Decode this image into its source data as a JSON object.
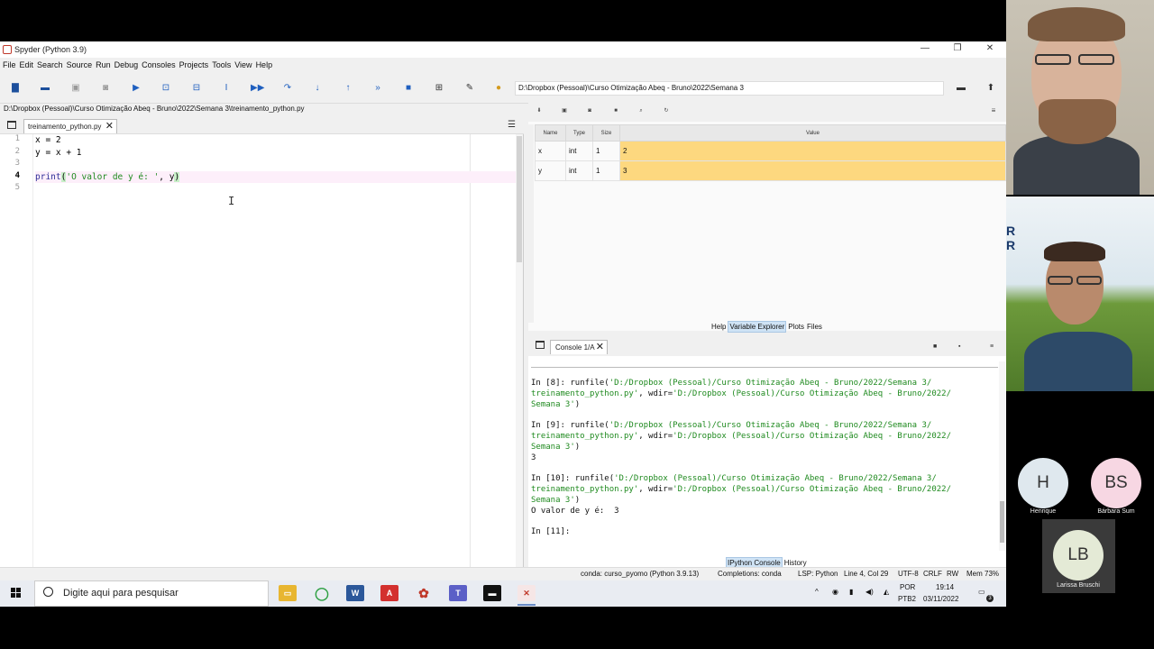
{
  "window": {
    "title": "Spyder (Python 3.9)",
    "controls": {
      "minimize": "—",
      "maximize": "❐",
      "close": "✕"
    }
  },
  "menu": [
    "File",
    "Edit",
    "Search",
    "Source",
    "Run",
    "Debug",
    "Consoles",
    "Projects",
    "Tools",
    "View",
    "Help"
  ],
  "toolbar": {
    "working_dir": "D:\\Dropbox (Pessoal)\\Curso Otimização Abeq - Bruno\\2022\\Semana 3"
  },
  "editor": {
    "file_path": "D:\\Dropbox (Pessoal)\\Curso Otimização Abeq - Bruno\\2022\\Semana 3\\treinamento_python.py",
    "tab_label": "treinamento_python.py",
    "line_numbers": [
      "1",
      "2",
      "3",
      "4",
      "5"
    ],
    "code": {
      "line1": "x = 2",
      "line2": "y = x + 1",
      "line3": "",
      "line4_kw": "print",
      "line4_open": "(",
      "line4_str": "'O valor de y é: '",
      "line4_rest": ", y",
      "line4_close": ")",
      "line5": ""
    }
  },
  "variable_explorer": {
    "columns": [
      "Name",
      "Type",
      "Size",
      "Value"
    ],
    "rows": [
      {
        "name": "x",
        "type": "int",
        "size": "1",
        "value": "2"
      },
      {
        "name": "y",
        "type": "int",
        "size": "1",
        "value": "3"
      }
    ],
    "tabs": [
      "Help",
      "Variable Explorer",
      "Plots",
      "Files"
    ],
    "value_color": "#fdd87f"
  },
  "console": {
    "tab_label": "Console 1/A",
    "blocks": [
      {
        "prompt": "In [8]: ",
        "cmd": "runfile(",
        "arg": "'D:/Dropbox (Pessoal)/Curso Otimização Abeq - Bruno/2022/Semana 3/",
        "arg2": "treinamento_python.py'",
        "mid": ", wdir=",
        "arg3": "'D:/Dropbox (Pessoal)/Curso Otimização Abeq - Bruno/2022/",
        "arg4": "Semana 3'",
        "end": ")",
        "output": ""
      },
      {
        "prompt": "In [9]: ",
        "cmd": "runfile(",
        "arg": "'D:/Dropbox (Pessoal)/Curso Otimização Abeq - Bruno/2022/Semana 3/",
        "arg2": "treinamento_python.py'",
        "mid": ", wdir=",
        "arg3": "'D:/Dropbox (Pessoal)/Curso Otimização Abeq - Bruno/2022/",
        "arg4": "Semana 3'",
        "end": ")",
        "output": "3"
      },
      {
        "prompt": "In [10]: ",
        "cmd": "runfile(",
        "arg": "'D:/Dropbox (Pessoal)/Curso Otimização Abeq - Bruno/2022/Semana 3/",
        "arg2": "treinamento_python.py'",
        "mid": ", wdir=",
        "arg3": "'D:/Dropbox (Pessoal)/Curso Otimização Abeq - Bruno/2022/",
        "arg4": "Semana 3'",
        "end": ")",
        "output": "O valor de y é:  3"
      }
    ],
    "current_prompt": "In [11]:",
    "tabs": [
      "IPython Console",
      "History"
    ]
  },
  "statusbar": {
    "env": "conda: curso_pyomo (Python 3.9.13)",
    "completions": "Completions: conda",
    "lsp": "LSP: Python",
    "position": "Line 4, Col 29",
    "encoding": "UTF-8",
    "eol": "CRLF",
    "mode": "RW",
    "mem": "Mem 73%"
  },
  "taskbar": {
    "search_placeholder": "Digite aqui para pesquisar",
    "lang_top": "POR",
    "lang_bottom": "PTB2",
    "time": "19:14",
    "date": "03/11/2022",
    "notifications": "3"
  },
  "participants": [
    {
      "initials": "H",
      "name": "Henrique",
      "color": "#dfe8ee"
    },
    {
      "initials": "BS",
      "name": "Bárbara Sum",
      "color": "#f7d7e3"
    },
    {
      "initials": "LB",
      "name": "Larissa Bruschi",
      "color": "#e4ead6"
    }
  ]
}
